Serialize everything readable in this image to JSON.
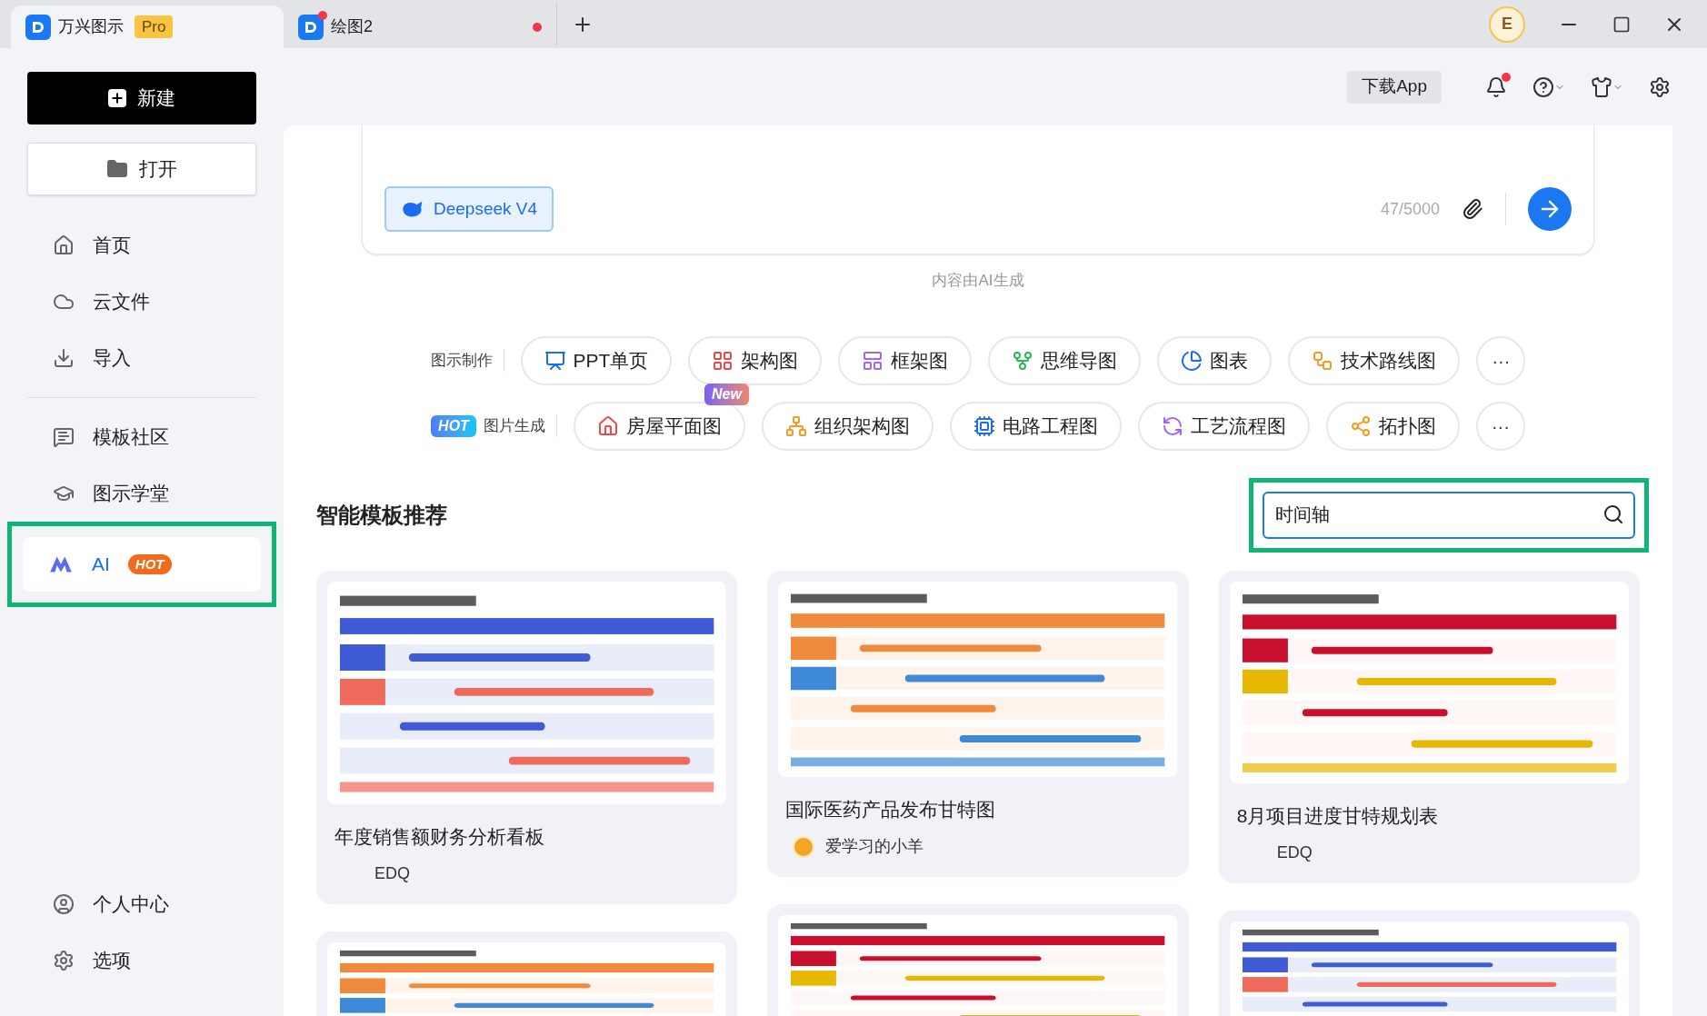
{
  "tabs": [
    {
      "title": "万兴图示",
      "badge": "Pro",
      "selected": true,
      "unsaved": false
    },
    {
      "title": "绘图2",
      "selected": false,
      "unsaved": true
    }
  ],
  "titlebar": {
    "avatar": "E"
  },
  "toolbar": {
    "download_button": "下载App",
    "has_unread": true
  },
  "sidebar": {
    "new_button": "新建",
    "open_button": "打开",
    "groups": [
      [
        {
          "label": "首页",
          "selected": false,
          "highlighted": false
        },
        {
          "label": "云文件",
          "selected": false,
          "highlighted": false
        },
        {
          "label": "导入",
          "selected": false,
          "highlighted": false
        }
      ],
      [
        {
          "label": "模板社区",
          "selected": false,
          "highlighted": false
        },
        {
          "label": "图示学堂",
          "selected": false,
          "highlighted": false
        },
        {
          "label": "AI",
          "badge": "HOT",
          "selected": true,
          "highlighted": true
        }
      ]
    ],
    "bottom": [
      {
        "label": "个人中心"
      },
      {
        "label": "选项"
      }
    ]
  },
  "ai_input": {
    "model": "Deepseek V4",
    "char_count": "47/5000",
    "disclaimer": "内容由AI生成"
  },
  "quick_rows": [
    {
      "label": "图示制作",
      "more": "···",
      "chips": [
        {
          "label": "PPT单页",
          "color": "#1a6cf0"
        },
        {
          "label": "架构图",
          "color": "#f04848"
        },
        {
          "label": "框架图",
          "color": "#a862f0"
        },
        {
          "label": "思维导图",
          "color": "#2db55d"
        },
        {
          "label": "图表",
          "color": "#1a6cf0"
        },
        {
          "label": "技术路线图",
          "color": "#f59a23"
        }
      ]
    },
    {
      "label": "图片生成",
      "badge": "HOT",
      "more": "···",
      "chips": [
        {
          "label": "房屋平面图",
          "color": "#f04848",
          "badge": "New"
        },
        {
          "label": "组织架构图",
          "color": "#f59a23"
        },
        {
          "label": "电路工程图",
          "color": "#1a6cf0"
        },
        {
          "label": "工艺流程图",
          "color": "#a862f0"
        },
        {
          "label": "拓扑图",
          "color": "#f59a23"
        }
      ]
    }
  ],
  "templates": {
    "title": "智能模板推荐",
    "search": {
      "value": "时间轴",
      "highlighted": true
    },
    "columns": [
      [
        {
          "title": "年度销售额财务分析看板",
          "author": "EDQ",
          "avatar": false
        },
        {
          "kind": "picture"
        }
      ],
      [
        {
          "title": "国际医药产品发布甘特图",
          "author": "爱学习的小羊",
          "avatar": true
        },
        {
          "kind": "picture"
        }
      ],
      [
        {
          "title": "8月项目进度甘特规划表",
          "author": "EDQ",
          "avatar": false
        },
        {
          "kind": "picture"
        }
      ]
    ]
  }
}
